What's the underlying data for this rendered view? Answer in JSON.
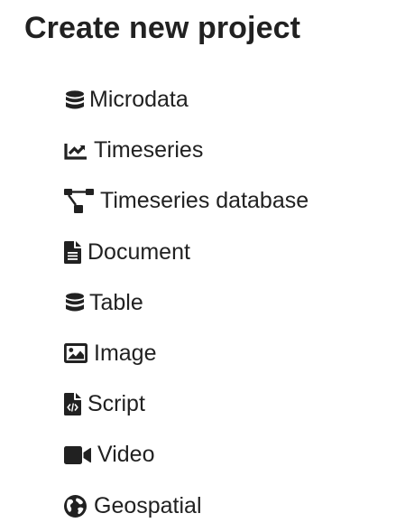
{
  "page": {
    "title": "Create new project"
  },
  "menu": {
    "items": [
      {
        "label": "Microdata",
        "icon": "database-icon"
      },
      {
        "label": "Timeseries",
        "icon": "line-chart-icon"
      },
      {
        "label": "Timeseries database",
        "icon": "project-diagram-icon"
      },
      {
        "label": "Document",
        "icon": "file-text-icon"
      },
      {
        "label": "Table",
        "icon": "database-icon"
      },
      {
        "label": "Image",
        "icon": "image-icon"
      },
      {
        "label": "Script",
        "icon": "file-code-icon"
      },
      {
        "label": "Video",
        "icon": "video-icon"
      },
      {
        "label": "Geospatial",
        "icon": "globe-icon"
      }
    ]
  },
  "colors": {
    "text": "#212121",
    "background": "#ffffff"
  }
}
